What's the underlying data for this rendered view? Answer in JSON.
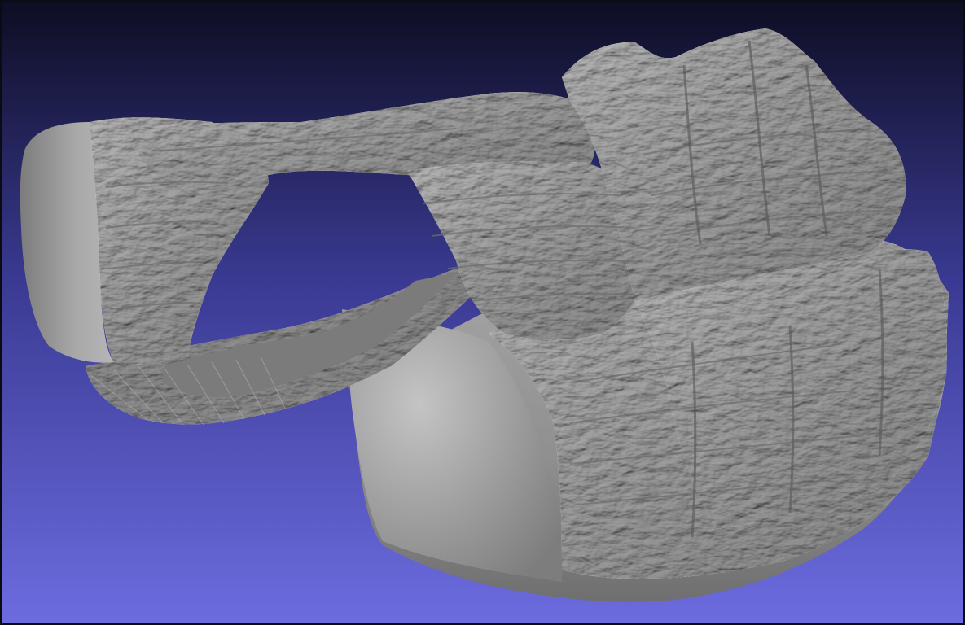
{
  "viewport": {
    "background_colors": {
      "top": "#0d0d22",
      "middle": "#3a3a93",
      "bottom": "#6c6ce0"
    },
    "mesh_color": "#9d9d9d",
    "mesh_highlight": "#c9c9c9",
    "mesh_shadow": "#5e5e5e"
  }
}
